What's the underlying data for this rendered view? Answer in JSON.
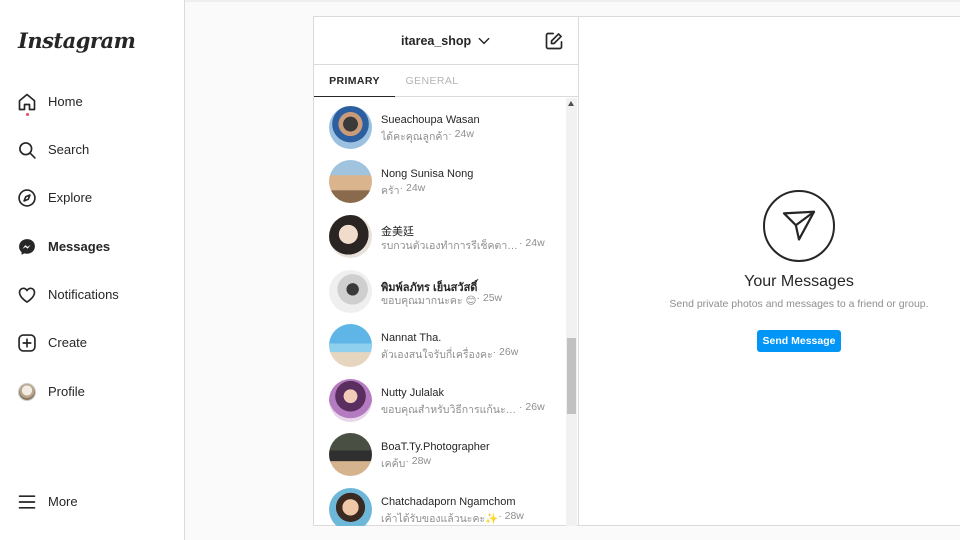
{
  "sidebar": {
    "logo": "Instagram",
    "items": [
      {
        "label": "Home",
        "icon": "home-icon"
      },
      {
        "label": "Search",
        "icon": "search-icon"
      },
      {
        "label": "Explore",
        "icon": "compass-icon"
      },
      {
        "label": "Messages",
        "icon": "messenger-icon",
        "active": true
      },
      {
        "label": "Notifications",
        "icon": "heart-icon"
      },
      {
        "label": "Create",
        "icon": "plus-square-icon"
      },
      {
        "label": "Profile",
        "icon": "avatar"
      }
    ],
    "more": {
      "label": "More",
      "icon": "menu-icon"
    }
  },
  "inbox": {
    "account": "itarea_shop",
    "tabs": [
      {
        "label": "PRIMARY",
        "active": true
      },
      {
        "label": "GENERAL",
        "active": false
      }
    ],
    "conversations": [
      {
        "name": "Sueachoupa Wasan",
        "message": "ได้คะคุณลูกค้า",
        "time": " · 24w",
        "bold": false
      },
      {
        "name": "Nong Sunisa Nong",
        "message": "ครัา",
        "time": " · 24w",
        "bold": false
      },
      {
        "name": "金美廷",
        "message": "รบกวนตัวเองทำการรีเช็คตามวิ...",
        "time": " · 24w",
        "bold": false
      },
      {
        "name": "พิมพ์ลภัทร เย็นสวัสดิ์",
        "message": "ขอบคุณมากนะคะ 😊",
        "time": " · 25w",
        "bold": true
      },
      {
        "name": "Nannat Tha.",
        "message": "ตัวเองสนใจรับกี่เครื่องคะ",
        "time": " · 26w",
        "bold": false
      },
      {
        "name": "Nutty Julalak",
        "message": "ขอบคุณสำหรับวิธีการแก้นะคะ ...",
        "time": " · 26w",
        "bold": false
      },
      {
        "name": "BoaT.Ty.Photographer",
        "message": "เคค้บ",
        "time": " · 28w",
        "bold": false
      },
      {
        "name": "Chatchadaporn Ngamchom",
        "message": "เค้าได้รับของแล้วนะคะ✨",
        "time": " · 28w",
        "bold": false
      }
    ]
  },
  "pane": {
    "title": "Your Messages",
    "subtitle": "Send private photos and messages to a friend or group.",
    "button": "Send Message"
  },
  "colors": {
    "accent": "#0095f6",
    "text": "#262626",
    "muted": "#8e8e8e",
    "border": "#dbdbdb",
    "notification_dot": "#ed4956"
  }
}
